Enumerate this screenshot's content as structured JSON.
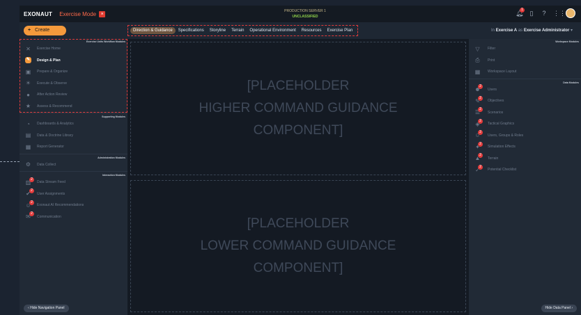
{
  "app": {
    "brand": "EXONAUT",
    "mode": "Exercise Mode",
    "mode_icon": "close-square-icon"
  },
  "server": {
    "line1": "PRODUCTION SERVER 1",
    "line2": "UNCLASSIFIED"
  },
  "topicons": {
    "notification_count": "1"
  },
  "create_label": "Create",
  "tabs": [
    "Direction & Guidance",
    "Specifications",
    "Storyline",
    "Terrain",
    "Operational Environment",
    "Resources",
    "Exercise Plan"
  ],
  "exercise_info": {
    "in_label": "In",
    "exercise": "Exercise A",
    "as_label": "as",
    "role": "Exercise Administrator"
  },
  "left": {
    "sections": {
      "exercise": "Exercise Units Workflow Modules",
      "supporting": "Supporting Modules",
      "administration": "Administration Modules",
      "interaction": "Interaction Modules"
    },
    "exercise_items": [
      "Exercise Home",
      "Design & Plan",
      "Prepare & Organize",
      "Execute & Observe",
      "After Action Review",
      "Assess & Recommend"
    ],
    "supporting_items": [
      "Dashboards & Analytics",
      "Data & Doctrine Library",
      "Report Generator"
    ],
    "admin_items": [
      "Data Collect"
    ],
    "interaction_items": [
      "Data Stream Feed",
      "User Assignments",
      "Exonaut AI Recommendations",
      "Communication"
    ],
    "badges": {
      "data_stream": "2",
      "user_assign": "2",
      "exonaut_ai": "2",
      "communication": "2"
    },
    "hide_label": "Hide Navigation Panel"
  },
  "center": {
    "upper": [
      "[PLACEHOLDER",
      "HIGHER COMMAND GUIDANCE",
      "COMPONENT]"
    ],
    "lower": [
      "[PLACEHOLDER",
      "LOWER COMMAND GUIDANCE",
      "COMPONENT]"
    ]
  },
  "right": {
    "sections": {
      "workspace": "Workspace Modules",
      "data": "Data Modules"
    },
    "workspace_items": [
      "Filter",
      "Print",
      "Workspace Layout"
    ],
    "data_items": [
      "Users",
      "Objectives",
      "Scenarios",
      "Tactical Graphics",
      "Users, Groups & Roles",
      "Simulation Effects",
      "Terrain",
      "Potential Checklist"
    ],
    "badge": "2",
    "hide_label": "Hide Data Panel"
  },
  "colors": {
    "accent": "#f59a3c",
    "alert": "#e23b3b",
    "classification": "#8fd04a"
  }
}
